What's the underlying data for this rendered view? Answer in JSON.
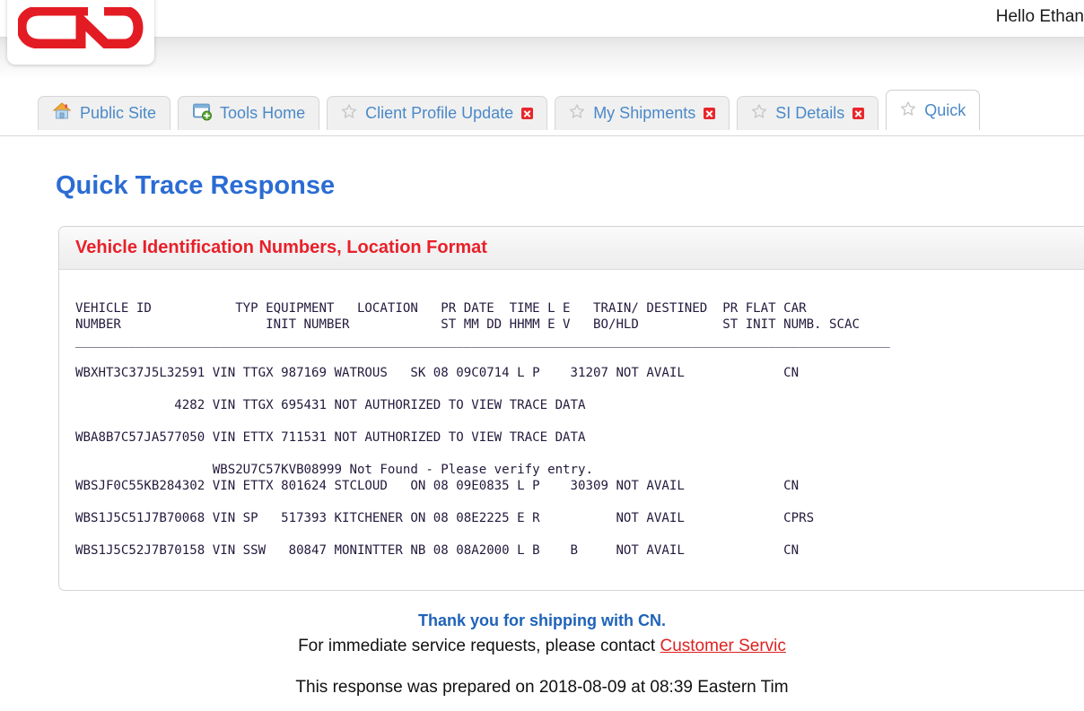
{
  "header": {
    "greeting": "Hello Ethan",
    "logo_alt": "CN"
  },
  "tabs": [
    {
      "label": "Public Site",
      "icon": "house-icon",
      "closable": false,
      "active": false
    },
    {
      "label": "Tools Home",
      "icon": "window-icon",
      "closable": false,
      "active": false
    },
    {
      "label": "Client Profile Update",
      "icon": "star-icon",
      "closable": true,
      "active": false
    },
    {
      "label": "My Shipments",
      "icon": "star-icon",
      "closable": true,
      "active": false
    },
    {
      "label": "SI Details",
      "icon": "star-icon",
      "closable": true,
      "active": false
    },
    {
      "label": "Quick",
      "icon": "star-icon",
      "closable": false,
      "active": true
    }
  ],
  "page": {
    "title": "Quick Trace Response"
  },
  "panel": {
    "title": "Vehicle Identification Numbers, Location Format"
  },
  "report": {
    "header_line_1": "VEHICLE ID           TYP EQUIPMENT   LOCATION   PR DATE  TIME L E   TRAIN/ DESTINED  PR FLAT CAR",
    "header_line_2": "NUMBER                   INIT NUMBER            ST MM DD HHMM E V   BO/HLD           ST INIT NUMB. SCAC",
    "rule": "___________________________________________________________________________________________________________",
    "rows": [
      "WBXHT3C37J5L32591 VIN TTGX 987169 WATROUS   SK 08 09C0714 L P    31207 NOT AVAIL             CN",
      "",
      "             4282 VIN TTGX 695431 NOT AUTHORIZED TO VIEW TRACE DATA",
      "",
      "WBA8B7C57JA577050 VIN ETTX 711531 NOT AUTHORIZED TO VIEW TRACE DATA",
      "",
      "                  WBS2U7C57KVB08999 Not Found - Please verify entry.",
      "WBSJF0C55KB284302 VIN ETTX 801624 STCLOUD   ON 08 09E0835 L P    30309 NOT AVAIL             CN",
      "",
      "WBS1J5C51J7B70068 VIN SP   517393 KITCHENER ON 08 08E2225 E R          NOT AVAIL             CPRS",
      "",
      "WBS1J5C52J7B70158 VIN SSW   80847 MONINTTER NB 08 08A2000 L B    B     NOT AVAIL             CN"
    ]
  },
  "footer": {
    "thanks": "Thank you for shipping with CN.",
    "contact_prefix": "For immediate service requests, please contact ",
    "contact_link": "Customer Servic",
    "prepared": "This response was prepared on 2018-08-09 at 08:39 Eastern Tim"
  },
  "colors": {
    "brand_red": "#e8202a",
    "title_blue": "#2b6cd4",
    "tab_blue": "#4a89c8",
    "link_red": "#e02020",
    "mono_text": "#241a3c"
  }
}
